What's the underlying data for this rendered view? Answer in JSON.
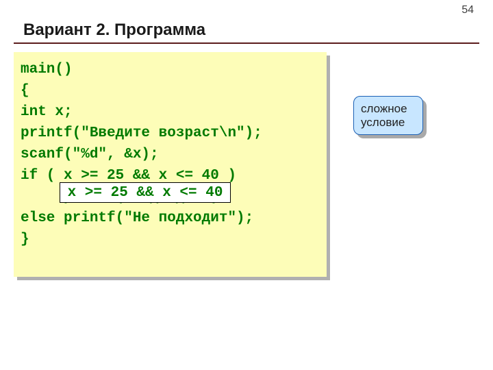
{
  "page_number": "54",
  "title": "Вариант 2. Программа",
  "code": {
    "l1": "main()",
    "l2": "{",
    "l3": "int x;",
    "l4": "printf(\"Введите возраст\\n\");",
    "l5": "scanf(\"%d\", &x);",
    "l6a": "if ( ",
    "l6b": "x >= 25 && x <= 40",
    "l6c": " )",
    "l7": "     printf(\"Подходит\");",
    "l8": "else printf(\"Не подходит\");",
    "l9": "}"
  },
  "callout": {
    "line1": "сложное",
    "line2": "условие"
  }
}
